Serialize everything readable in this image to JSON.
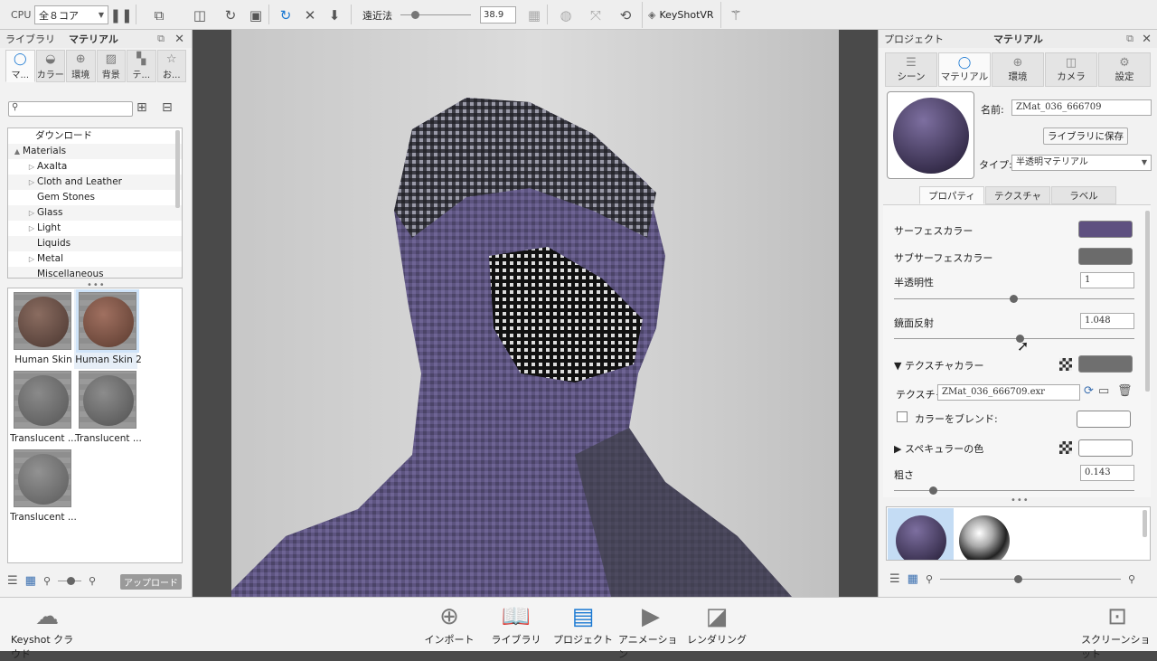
{
  "toolbar": {
    "cpu_label": "CPU",
    "cpu_select": "全８コア",
    "perspective_label": "遠近法",
    "perspective_value": "38.9",
    "keyshotvr": "KeyShotVR"
  },
  "left": {
    "title_library": "ライブラリ",
    "title_material": "マテリアル",
    "tabs": [
      {
        "label": "マ...",
        "icon": "material-icon"
      },
      {
        "label": "カラー",
        "icon": "color-icon"
      },
      {
        "label": "環境",
        "icon": "environment-icon"
      },
      {
        "label": "背景",
        "icon": "background-icon"
      },
      {
        "label": "テ...",
        "icon": "texture-icon"
      },
      {
        "label": "お...",
        "icon": "favorites-icon"
      }
    ],
    "tree": [
      {
        "label": "ダウンロード",
        "arrow": ""
      },
      {
        "label": "Materials",
        "arrow": "▲"
      },
      {
        "label": "Axalta",
        "arrow": "▷"
      },
      {
        "label": "Cloth and Leather",
        "arrow": "▷"
      },
      {
        "label": "Gem Stones",
        "arrow": ""
      },
      {
        "label": "Glass",
        "arrow": "▷"
      },
      {
        "label": "Light",
        "arrow": "▷"
      },
      {
        "label": "Liquids",
        "arrow": ""
      },
      {
        "label": "Metal",
        "arrow": "▷"
      },
      {
        "label": "Miscellaneous",
        "arrow": ""
      }
    ],
    "thumbs": [
      {
        "label": "Human Skin",
        "color": "#6b5248"
      },
      {
        "label": "Human Skin 2",
        "color": "#7a5546"
      },
      {
        "label": "Translucent ...",
        "color": "#6f6f6f"
      },
      {
        "label": "Translucent ...",
        "color": "#727272"
      },
      {
        "label": "Translucent ...",
        "color": "#767676"
      }
    ],
    "upload": "アップロード"
  },
  "right": {
    "title_project": "プロジェクト",
    "title_material": "マテリアル",
    "tabs": [
      {
        "label": "シーン",
        "icon": "scene-icon"
      },
      {
        "label": "マテリアル",
        "icon": "material-icon"
      },
      {
        "label": "環境",
        "icon": "environment-icon"
      },
      {
        "label": "カメラ",
        "icon": "camera-icon"
      },
      {
        "label": "設定",
        "icon": "settings-icon"
      }
    ],
    "name_label": "名前:",
    "name_value": "ZMat_036_666709",
    "save_button": "ライブラリに保存",
    "type_label": "タイプ:",
    "type_value": "半透明マテリアル",
    "prop_tabs": [
      "プロパティ",
      "テクスチャ",
      "ラベル"
    ],
    "surface_color_label": "サーフェスカラー",
    "surface_color": "#5e5080",
    "subsurface_color_label": "サブサーフェスカラー",
    "subsurface_color": "#6b6b6b",
    "translucency_label": "半透明性",
    "translucency_value": "1",
    "specular_label": "鏡面反射",
    "specular_value": "1.048",
    "texture_color_label": "テクスチャカラー",
    "texture_label": "テクスチャ:",
    "texture_file": "ZMat_036_666709.exr",
    "blend_label": "カラーをブレンド:",
    "specular_color_label": "スペキュラーの色",
    "roughness_label": "粗さ",
    "roughness_value": "0.143"
  },
  "bottom": {
    "cloud": "Keyshot クラウド",
    "buttons": [
      "インポート",
      "ライブラリ",
      "プロジェクト",
      "アニメーション",
      "レンダリング"
    ],
    "screenshot": "スクリーンショット"
  }
}
